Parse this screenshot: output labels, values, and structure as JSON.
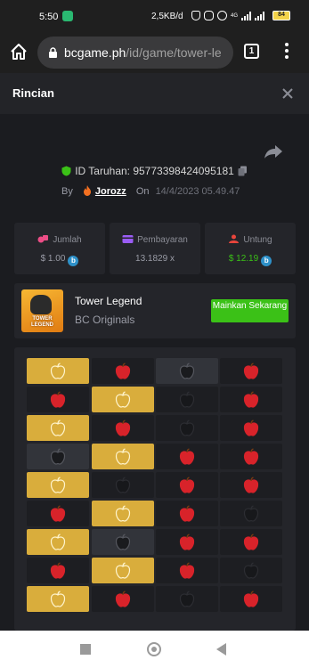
{
  "status_bar": {
    "time": "5:50",
    "network": "2,5KB/d",
    "network_type": "4G",
    "battery": "84"
  },
  "browser": {
    "home_icon": "home-icon",
    "lock_icon": "lock-icon",
    "url_host": "bcgame.ph",
    "url_path": "/id/game/tower-le",
    "tab_count": "1",
    "menu_icon": "more-vert-icon"
  },
  "modal": {
    "title": "Rincian",
    "close_icon": "close-icon"
  },
  "bet": {
    "id_label": "ID Taruhan: 95773398424095181",
    "by_label": "By",
    "user": "Jorozz",
    "on_label": "On",
    "date": "14/4/2023 05.49.47"
  },
  "stats": {
    "amount_label": "Jumlah",
    "amount_value": "$ 1.00",
    "payout_label": "Pembayaran",
    "payout_value": "13.1829 x",
    "profit_label": "Untung",
    "profit_value": "$ 12.19",
    "coin_label": "b"
  },
  "game": {
    "thumb_text": "TOWER LEGEND",
    "name": "Tower Legend",
    "provider": "BC Originals",
    "play_label": "Mainkan Sekarang"
  },
  "colors": {
    "accent_green": "#3bc117",
    "gold_tile": "#d9ad3c",
    "apple_red": "#d8232a",
    "background": "#1b1c20",
    "card": "#24252a"
  },
  "board": {
    "rows": [
      [
        "gold",
        "red",
        "gray",
        "red"
      ],
      [
        "red",
        "gold",
        "dark",
        "red"
      ],
      [
        "gold",
        "red",
        "dark",
        "red"
      ],
      [
        "gray",
        "gold",
        "red",
        "red"
      ],
      [
        "gold",
        "dark",
        "red",
        "red"
      ],
      [
        "red",
        "gold",
        "red",
        "dark"
      ],
      [
        "gold",
        "gray",
        "red",
        "red"
      ],
      [
        "red",
        "gold",
        "red",
        "dark"
      ],
      [
        "gold",
        "red",
        "dark",
        "red"
      ]
    ]
  }
}
